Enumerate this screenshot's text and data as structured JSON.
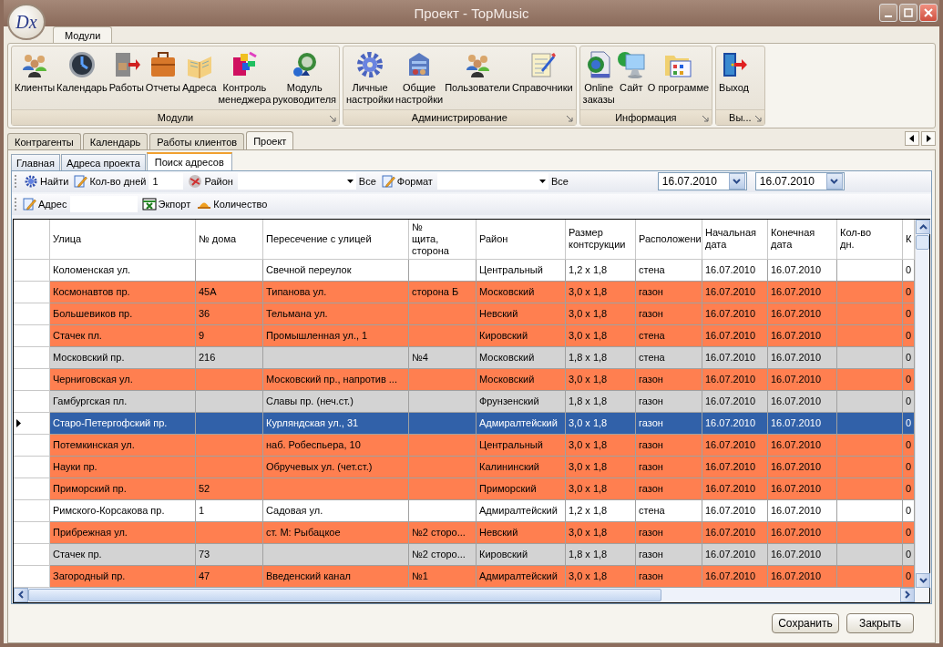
{
  "window": {
    "title": "Проект - TopMusic",
    "logo": "Dx"
  },
  "ribbon": {
    "tabs": [
      {
        "label": "Модули",
        "selected": true
      }
    ],
    "groups": [
      {
        "label": "Модули",
        "buttons": [
          "Клиенты",
          "Календарь",
          "Работы",
          "Отчеты",
          "Адреса",
          "Контроль\nменеджера",
          "Модуль\nруководителя"
        ]
      },
      {
        "label": "Администрирование",
        "buttons": [
          "Личные\nнастройки",
          "Общие\nнастройки",
          "Пользователи",
          "Справочники"
        ]
      },
      {
        "label": "Информация",
        "buttons": [
          "Online\nзаказы",
          "Сайт",
          "О программе"
        ]
      },
      {
        "label": "Вы...",
        "buttons": [
          "Выход"
        ]
      }
    ]
  },
  "document_tabs": [
    {
      "label": "Контрагенты",
      "selected": false
    },
    {
      "label": "Календарь",
      "selected": false
    },
    {
      "label": "Работы клиентов",
      "selected": false
    },
    {
      "label": "Проект",
      "selected": true
    }
  ],
  "inner_tabs": [
    {
      "label": "Главная",
      "selected": false
    },
    {
      "label": "Адреса проекта",
      "selected": false
    },
    {
      "label": "Поиск адресов",
      "selected": true
    }
  ],
  "toolbar_1": {
    "find": "Найти",
    "days_label": "Кол-во дней",
    "days_value": "1",
    "district_label": "Район",
    "district_all": "Все",
    "format_label": "Формат",
    "format_all": "Все",
    "date_from": "16.07.2010",
    "date_to": "16.07.2010"
  },
  "toolbar_2": {
    "address_label": "Адрес",
    "export": "Экпорт",
    "count": "Количество"
  },
  "table": {
    "columns": [
      "Улица",
      "№ дома",
      "Пересечение с улицей",
      "№\nщита,\nсторона",
      "Район",
      "Размер\nконтсрукции",
      "Расположени",
      "Начальная\nдата",
      "Конечная\nдата",
      "Кол-во\nдн.",
      "К"
    ],
    "rows": [
      {
        "selected": false,
        "color": "#ffffff",
        "cells": [
          "Коломенская ул.",
          null,
          "Свечной переулок",
          null,
          "Центральный",
          "1,2 x 1,8",
          "стена",
          "16.07.2010",
          "16.07.2010",
          null,
          "0"
        ]
      },
      {
        "selected": false,
        "color": "#ff7f50",
        "cells": [
          "Космонавтов пр.",
          "45А",
          "Типанова ул.",
          "сторона Б",
          "Московский",
          "3,0 x 1,8",
          "газон",
          "16.07.2010",
          "16.07.2010",
          null,
          "0"
        ]
      },
      {
        "selected": false,
        "color": "#ff7f50",
        "cells": [
          "Большевиков пр.",
          "36",
          "Тельмана ул.",
          null,
          "Невский",
          "3,0 x 1,8",
          "газон",
          "16.07.2010",
          "16.07.2010",
          null,
          "0"
        ]
      },
      {
        "selected": false,
        "color": "#ff7f50",
        "cells": [
          "Стачек пл.",
          "9",
          "Промышленная ул., 1",
          null,
          "Кировский",
          "3,0 x 1,8",
          "стена",
          "16.07.2010",
          "16.07.2010",
          null,
          "0"
        ]
      },
      {
        "selected": false,
        "color": "#d3d3d3",
        "cells": [
          "Московский пр.",
          "216",
          null,
          "№4",
          "Московский",
          "1,8 x 1,8",
          "стена",
          "16.07.2010",
          "16.07.2010",
          null,
          "0"
        ]
      },
      {
        "selected": false,
        "color": "#ff7f50",
        "cells": [
          "Черниговская ул.",
          null,
          "Московский пр., напротив ...",
          null,
          "Московский",
          "3,0 x 1,8",
          "газон",
          "16.07.2010",
          "16.07.2010",
          null,
          "0"
        ]
      },
      {
        "selected": false,
        "color": "#d3d3d3",
        "cells": [
          "Гамбургская пл.",
          null,
          "Славы пр. (неч.ст.)",
          null,
          "Фрунзенский",
          "1,8 x 1,8",
          "газон",
          "16.07.2010",
          "16.07.2010",
          null,
          "0"
        ]
      },
      {
        "selected": true,
        "cells": [
          "Старо-Петергофский пр.",
          null,
          "Курляндская ул., 31",
          null,
          "Адмиралтейский",
          "3,0 x 1,8",
          "газон",
          "16.07.2010",
          "16.07.2010",
          null,
          "0"
        ]
      },
      {
        "selected": false,
        "color": "#ff7f50",
        "cells": [
          "Потемкинская ул.",
          null,
          "наб. Робеспьера, 10",
          null,
          "Центральный",
          "3,0 x 1,8",
          "газон",
          "16.07.2010",
          "16.07.2010",
          null,
          "0"
        ]
      },
      {
        "selected": false,
        "color": "#ff7f50",
        "cells": [
          "Науки пр.",
          null,
          "Обручевых ул. (чет.ст.)",
          null,
          "Калининский",
          "3,0 x 1,8",
          "газон",
          "16.07.2010",
          "16.07.2010",
          null,
          "0"
        ]
      },
      {
        "selected": false,
        "color": "#ff7f50",
        "cells": [
          "Приморский пр.",
          "52",
          null,
          null,
          "Приморский",
          "3,0 x 1,8",
          "газон",
          "16.07.2010",
          "16.07.2010",
          null,
          "0"
        ]
      },
      {
        "selected": false,
        "color": "#ffffff",
        "cells": [
          "Римского-Корсакова пр.",
          "1",
          "Садовая ул.",
          null,
          "Адмиралтейский",
          "1,2 x 1,8",
          "стена",
          "16.07.2010",
          "16.07.2010",
          null,
          "0"
        ]
      },
      {
        "selected": false,
        "color": "#ff7f50",
        "cells": [
          "Прибрежная ул.",
          null,
          "ст. М: Рыбацкое",
          "№2 сторо...",
          "Невский",
          "3,0 x 1,8",
          "газон",
          "16.07.2010",
          "16.07.2010",
          null,
          "0"
        ]
      },
      {
        "selected": false,
        "color": "#d3d3d3",
        "cells": [
          "Стачек пр.",
          "73",
          null,
          "№2 сторо...",
          "Кировский",
          "1,8 x 1,8",
          "газон",
          "16.07.2010",
          "16.07.2010",
          null,
          "0"
        ]
      },
      {
        "selected": false,
        "color": "#ff7f50",
        "cells": [
          "Загородный пр.",
          "47",
          "Введенский канал",
          "№1",
          "Адмиралтейский",
          "3,0 x 1,8",
          "газон",
          "16.07.2010",
          "16.07.2010",
          null,
          "0"
        ]
      }
    ]
  },
  "buttons": [
    "Сохранить",
    "Закрыть"
  ]
}
